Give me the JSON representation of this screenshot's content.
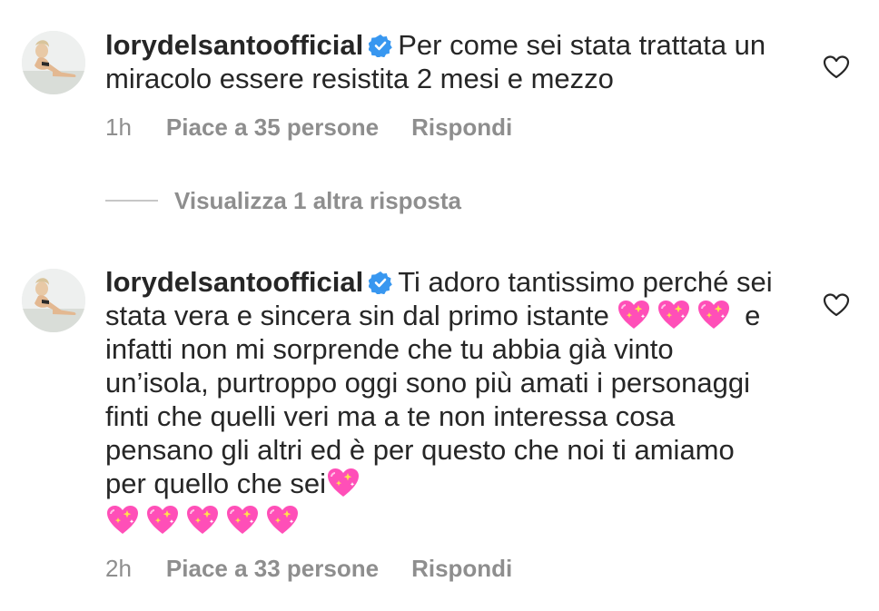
{
  "comments": [
    {
      "username": "lorydelsantoofficial",
      "text": "Per come sei stata trattata un miracolo essere resistita 2 mesi e mezzo",
      "time": "1h",
      "likes": "Piace a 35 persone",
      "reply": "Rispondi"
    },
    {
      "username": "lorydelsantoofficial",
      "text_part1": "Ti adoro tantissimo perché sei stata vera e sincera sin dal primo istante",
      "text_part2": " e infatti non mi sorprende che tu abbia già vinto un’isola, purtroppo oggi sono più amati i personaggi finti che quelli veri ma a te non interessa cosa pensano gli altri ed è per questo che noi ti amiamo per quello che sei",
      "time": "2h",
      "likes": "Piace a 33 persone",
      "reply": "Rispondi"
    }
  ],
  "view_replies": "Visualizza 1 altra risposta",
  "icons": {
    "verified": "verified-badge-icon",
    "like": "heart-outline-icon",
    "emoji": "sparkling-heart-emoji"
  },
  "colors": {
    "verified": "#3897f0",
    "secondary_text": "#8e8e8e",
    "emoji_pink": "#ff4fb8"
  }
}
